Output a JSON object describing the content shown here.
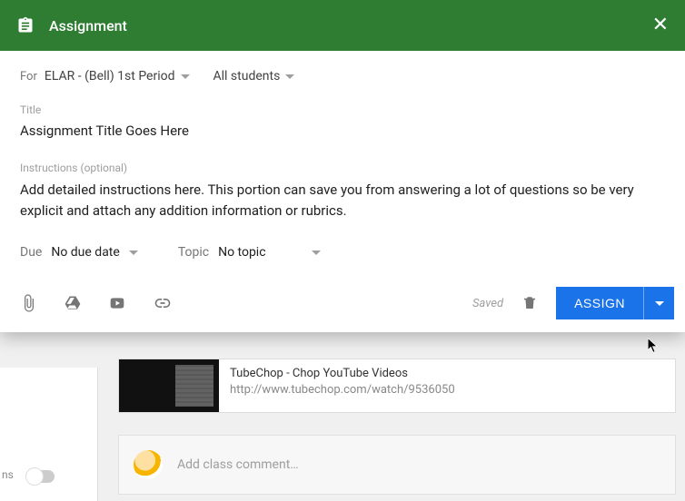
{
  "header": {
    "title": "Assignment"
  },
  "for_section": {
    "label": "For",
    "class_name": "ELAR - (Bell) 1st Period",
    "students": "All students"
  },
  "title_field": {
    "label": "Title",
    "value": "Assignment Title Goes Here"
  },
  "instructions_field": {
    "label": "Instructions (optional)",
    "value": "Add detailed instructions here. This portion can save you from answering a lot of questions so be very explicit and attach any addition information or rubrics."
  },
  "due": {
    "label": "Due",
    "value": "No due date"
  },
  "topic": {
    "label": "Topic",
    "value": "No topic"
  },
  "footer": {
    "saved": "Saved",
    "assign": "ASSIGN"
  },
  "background": {
    "toggle_label": "ns",
    "attachment_title": "TubeChop - Chop YouTube Videos",
    "attachment_url": "http://www.tubechop.com/watch/9536050",
    "comment_placeholder": "Add class comment…"
  }
}
